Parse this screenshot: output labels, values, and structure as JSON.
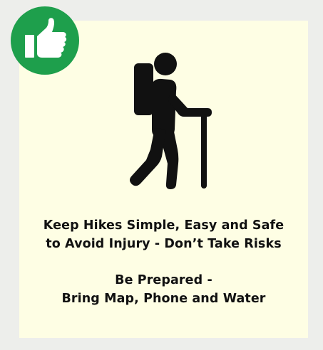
{
  "badge": {
    "icon": "thumbs-up-icon",
    "color": "#1e9f4c"
  },
  "illustration": {
    "icon": "hiker-with-backpack-and-cane-icon",
    "color": "#111111"
  },
  "card": {
    "background": "#fefee4"
  },
  "message": {
    "line1": "Keep Hikes Simple, Easy and Safe",
    "line2": "to Avoid Injury - Don’t Take Risks",
    "line3": "Be Prepared -",
    "line4": "Bring Map, Phone and Water"
  }
}
